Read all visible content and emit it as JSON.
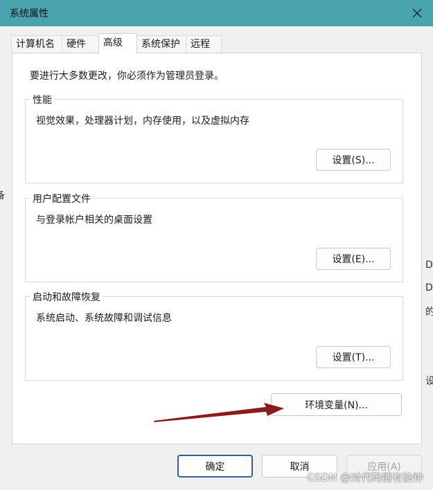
{
  "window": {
    "title": "系统属性",
    "close_icon": "close-icon",
    "titlebar_color": "#4aa4b0"
  },
  "tabs": [
    {
      "label": "计算机名"
    },
    {
      "label": "硬件"
    },
    {
      "label": "高级",
      "active": true
    },
    {
      "label": "系统保护"
    },
    {
      "label": "远程"
    }
  ],
  "advanced": {
    "notice": "要进行大多数更改，你必须作为管理员登录。",
    "performance": {
      "title": "性能",
      "description": "视觉效果，处理器计划，内存使用，以及虚拟内存",
      "button": "设置(S)..."
    },
    "user_profiles": {
      "title": "用户配置文件",
      "description": "与登录帐户相关的桌面设置",
      "button": "设置(E)..."
    },
    "startup_recovery": {
      "title": "启动和故障恢复",
      "description": "系统启动、系统故障和调试信息",
      "button": "设置(T)..."
    },
    "env_button": "环境变量(N)...",
    "annotation_arrow_color": "#8b1a1a"
  },
  "footer": {
    "ok": "确定",
    "cancel": "取消",
    "apply": "应用(A)"
  },
  "watermark": "CSDN @对代码情有独钟",
  "background_edge": {
    "left_char": "备",
    "right_chars": [
      "D",
      "D",
      "的",
      "设"
    ]
  }
}
